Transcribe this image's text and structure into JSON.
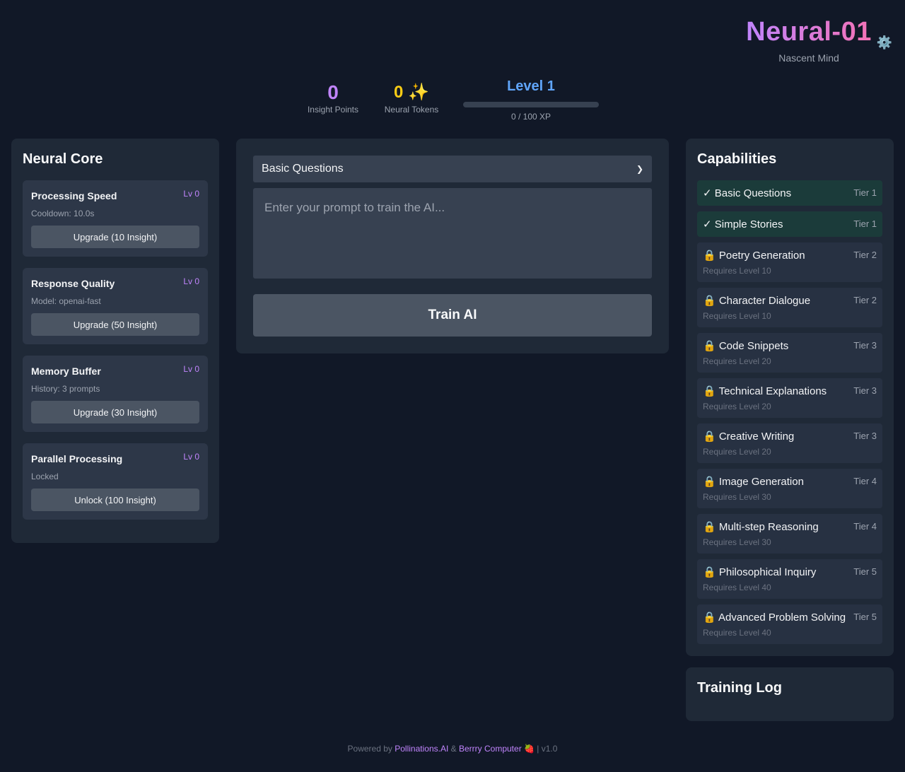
{
  "brand": {
    "title": "Neural-01",
    "subtitle": "Nascent Mind",
    "settings_icon": "gear-icon"
  },
  "stats": {
    "insight_value": "0",
    "insight_label": "Insight Points",
    "tokens_value": "0 ✨",
    "tokens_label": "Neural Tokens",
    "level_title": "Level 1",
    "xp_text": "0 / 100 XP",
    "xp_progress": 0
  },
  "core": {
    "title": "Neural Core",
    "upgrades": [
      {
        "name": "Processing Speed",
        "level": "Lv 0",
        "desc": "Cooldown: 10.0s",
        "button": "Upgrade (10 Insight)"
      },
      {
        "name": "Response Quality",
        "level": "Lv 0",
        "desc": "Model: openai-fast",
        "button": "Upgrade (50 Insight)"
      },
      {
        "name": "Memory Buffer",
        "level": "Lv 0",
        "desc": "History: 3 prompts",
        "button": "Upgrade (30 Insight)"
      },
      {
        "name": "Parallel Processing",
        "level": "Lv 0",
        "desc": "Locked",
        "button": "Unlock (100 Insight)"
      }
    ]
  },
  "trainer": {
    "selected_mode": "Basic Questions",
    "prompt_placeholder": "Enter your prompt to train the AI...",
    "prompt_value": "",
    "train_button": "Train AI"
  },
  "capabilities": {
    "title": "Capabilities",
    "items": [
      {
        "name": "✓ Basic Questions",
        "tier": "Tier 1",
        "unlocked": true
      },
      {
        "name": "✓ Simple Stories",
        "tier": "Tier 1",
        "unlocked": true
      },
      {
        "name": "🔒 Poetry Generation",
        "tier": "Tier 2",
        "req": "Requires Level 10",
        "unlocked": false
      },
      {
        "name": "🔒 Character Dialogue",
        "tier": "Tier 2",
        "req": "Requires Level 10",
        "unlocked": false
      },
      {
        "name": "🔒 Code Snippets",
        "tier": "Tier 3",
        "req": "Requires Level 20",
        "unlocked": false
      },
      {
        "name": "🔒 Technical Explanations",
        "tier": "Tier 3",
        "req": "Requires Level 20",
        "unlocked": false
      },
      {
        "name": "🔒 Creative Writing",
        "tier": "Tier 3",
        "req": "Requires Level 20",
        "unlocked": false
      },
      {
        "name": "🔒 Image Generation",
        "tier": "Tier 4",
        "req": "Requires Level 30",
        "unlocked": false
      },
      {
        "name": "🔒 Multi-step Reasoning",
        "tier": "Tier 4",
        "req": "Requires Level 30",
        "unlocked": false
      },
      {
        "name": "🔒 Philosophical Inquiry",
        "tier": "Tier 5",
        "req": "Requires Level 40",
        "unlocked": false
      },
      {
        "name": "🔒 Advanced Problem Solving",
        "tier": "Tier 5",
        "req": "Requires Level 40",
        "unlocked": false
      }
    ]
  },
  "log": {
    "title": "Training Log"
  },
  "footer": {
    "prefix": "Powered by",
    "link1": "Pollinations.AI",
    "amp": "&",
    "link2": "Berrry Computer",
    "suffix": "🍓 | v1.0"
  },
  "colors": {
    "background": "#111827",
    "panel": "#1f2937",
    "accent_purple": "#c084fc",
    "accent_blue": "#60a5fa",
    "accent_yellow": "#facc15",
    "unlocked_bg": "#1b3b3a"
  }
}
